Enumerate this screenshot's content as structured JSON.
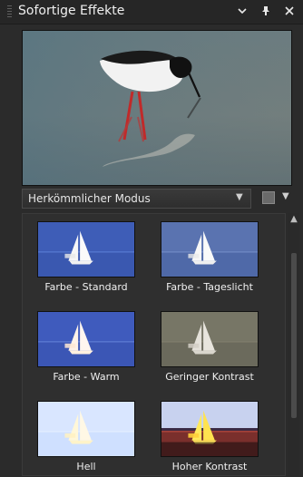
{
  "panel": {
    "title": "Sofortige Effekte",
    "title_buttons": [
      {
        "name": "panel-menu",
        "icon": "chevron-down-icon"
      },
      {
        "name": "pin",
        "icon": "pin-icon"
      },
      {
        "name": "close",
        "icon": "close-icon"
      }
    ]
  },
  "mode": {
    "selected": "Herkömmlicher Modus"
  },
  "presets": [
    {
      "label": "Farbe - Standard",
      "look": "standard"
    },
    {
      "label": "Farbe - Tageslicht",
      "look": "daylight"
    },
    {
      "label": "Farbe - Warm",
      "look": "warm"
    },
    {
      "label": "Geringer Kontrast",
      "look": "lowcontrast"
    },
    {
      "label": "Hell",
      "look": "bright"
    },
    {
      "label": "Hoher Kontrast",
      "look": "highcontrast"
    }
  ],
  "colors": {
    "panel_bg": "#2b2b2b",
    "text": "#e6e6e6"
  }
}
